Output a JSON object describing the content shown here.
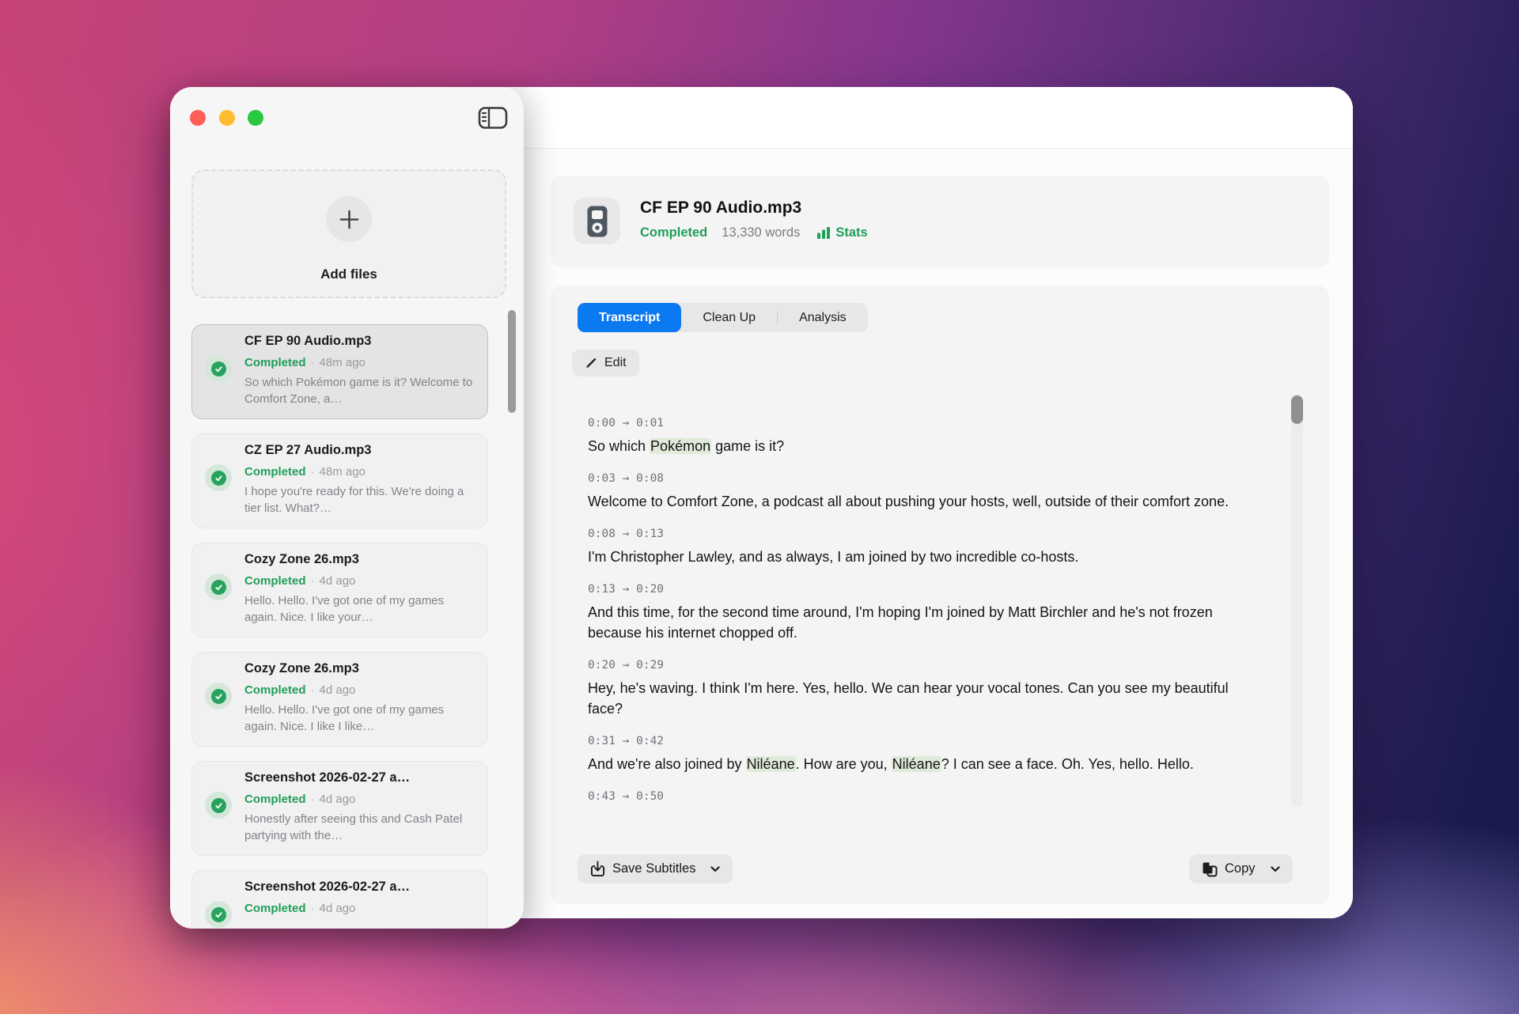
{
  "colors": {
    "accent_green": "#1f9e57",
    "accent_blue": "#0b79f0",
    "highlight_green": "#dfead8",
    "traffic_close": "#ff5f57",
    "traffic_minimize": "#febc2e",
    "traffic_zoom": "#28c840"
  },
  "sidebar": {
    "add_files_label": "Add files",
    "meta_separator": "·",
    "items": [
      {
        "title": "CF EP 90 Audio.mp3",
        "status": "Completed",
        "time": "48m ago",
        "preview": "So which Pokémon game is it? Welcome to Comfort Zone, a…",
        "selected": true
      },
      {
        "title": "CZ EP 27 Audio.mp3",
        "status": "Completed",
        "time": "48m ago",
        "preview": "I hope you're ready for this. We're doing a tier list. What?…",
        "selected": false
      },
      {
        "title": "Cozy Zone 26.mp3",
        "status": "Completed",
        "time": "4d ago",
        "preview": "Hello. Hello. I've got one of my games again. Nice. I like your…",
        "selected": false
      },
      {
        "title": "Cozy Zone 26.mp3",
        "status": "Completed",
        "time": "4d ago",
        "preview": "Hello. Hello. I've got one of my games again. Nice. I like I like…",
        "selected": false
      },
      {
        "title": "Screenshot 2026-02-27 a…",
        "status": "Completed",
        "time": "4d ago",
        "preview": "Honestly after seeing this and Cash Patel partying with the…",
        "selected": false
      },
      {
        "title": "Screenshot 2026-02-27 a…",
        "status": "Completed",
        "time": "4d ago",
        "preview": "",
        "selected": false
      }
    ]
  },
  "header": {
    "title": "CF EP 90 Audio.mp3",
    "status": "Completed",
    "words": "13,330 words",
    "stats_label": "Stats"
  },
  "tabs": [
    {
      "label": "Transcript",
      "active": true
    },
    {
      "label": "Clean Up",
      "active": false
    },
    {
      "label": "Analysis",
      "active": false
    }
  ],
  "edit_label": "Edit",
  "transcript": {
    "arrow": "→",
    "segments": [
      {
        "start": "0:00",
        "end": "0:01",
        "parts": [
          {
            "text": "So which ",
            "highlight": false
          },
          {
            "text": "Pokémon",
            "highlight": true
          },
          {
            "text": " game is it?",
            "highlight": false
          }
        ]
      },
      {
        "start": "0:03",
        "end": "0:08",
        "parts": [
          {
            "text": "Welcome to Comfort Zone, a podcast all about pushing your hosts, well, outside of their comfort zone.",
            "highlight": false
          }
        ]
      },
      {
        "start": "0:08",
        "end": "0:13",
        "parts": [
          {
            "text": "I'm Christopher Lawley, and as always, I am joined by two incredible co-hosts.",
            "highlight": false
          }
        ]
      },
      {
        "start": "0:13",
        "end": "0:20",
        "parts": [
          {
            "text": "And this time, for the second time around, I'm hoping I'm joined by Matt Birchler and he's not frozen because his internet chopped off.",
            "highlight": false
          }
        ]
      },
      {
        "start": "0:20",
        "end": "0:29",
        "parts": [
          {
            "text": "Hey, he's waving. I think I'm here. Yes, hello. We can hear your vocal tones. Can you see my beautiful face?",
            "highlight": false
          }
        ]
      },
      {
        "start": "0:31",
        "end": "0:42",
        "parts": [
          {
            "text": "And we're also joined by ",
            "highlight": false
          },
          {
            "text": "Niléane",
            "highlight": true
          },
          {
            "text": ". How are you, ",
            "highlight": false
          },
          {
            "text": "Niléane",
            "highlight": true
          },
          {
            "text": "? I can see a face. Oh. Yes, hello. Hello.",
            "highlight": false
          }
        ]
      },
      {
        "start": "0:43",
        "end": "0:50",
        "parts": []
      }
    ]
  },
  "footer": {
    "save_label": "Save Subtitles",
    "copy_label": "Copy"
  }
}
